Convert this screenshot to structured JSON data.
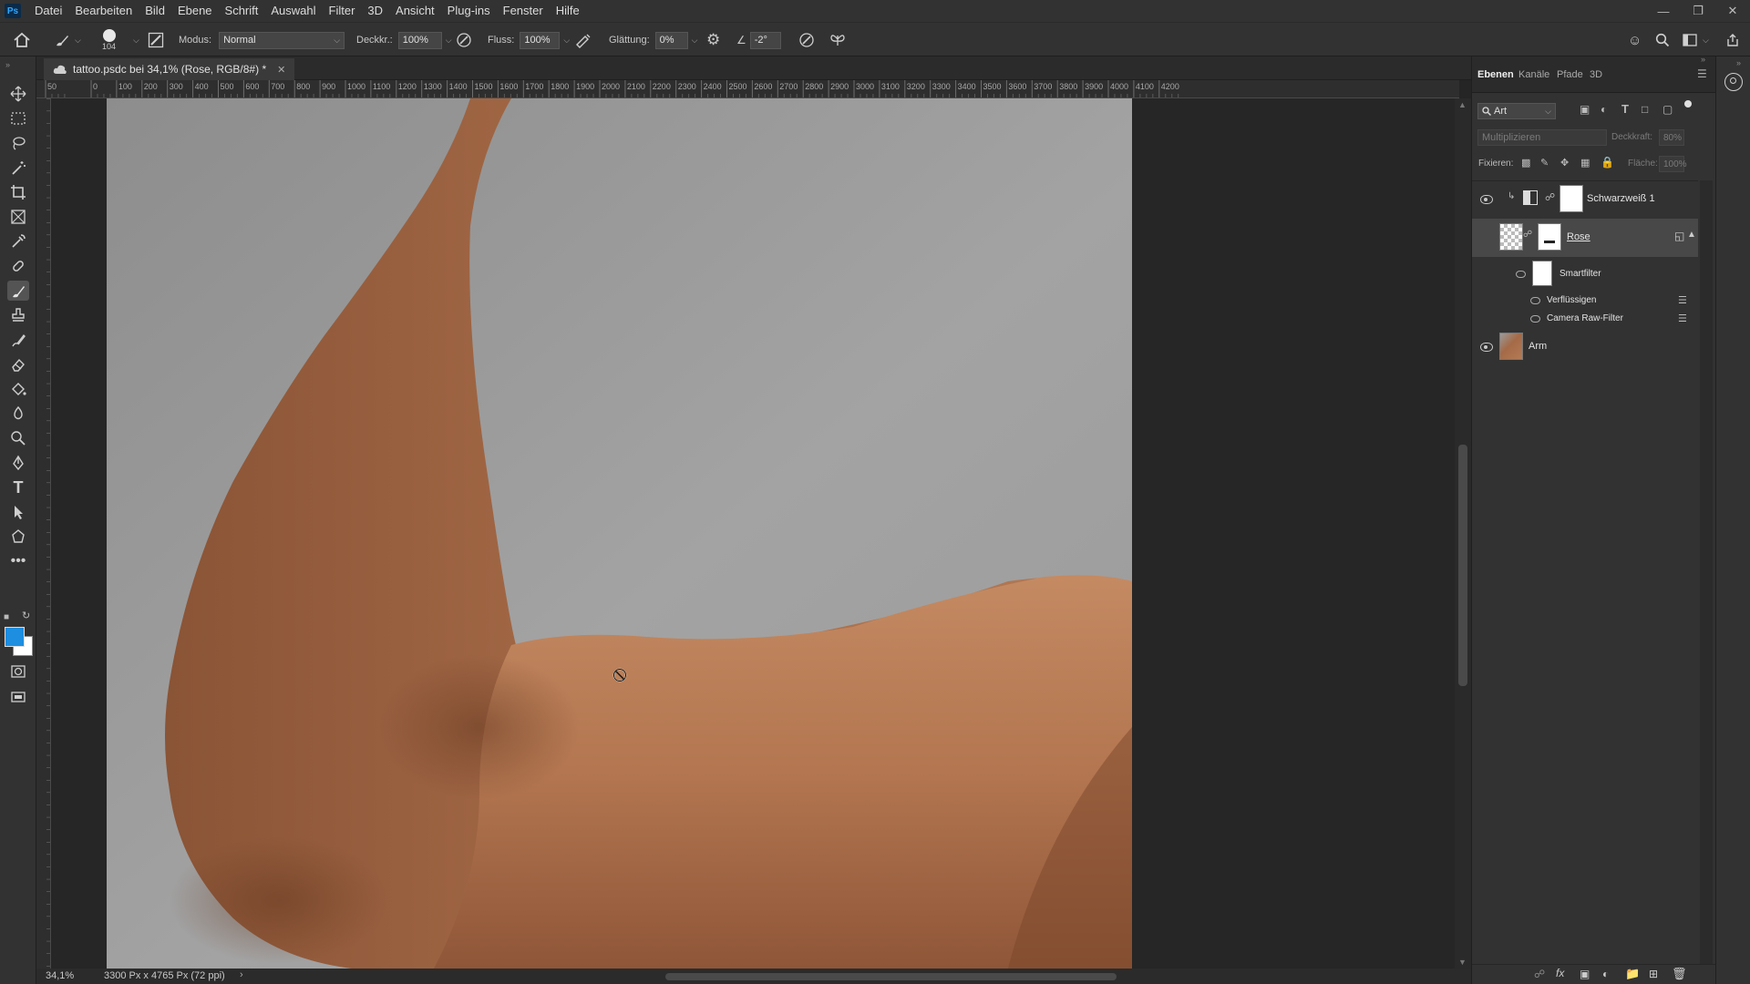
{
  "app": {
    "logo": "Ps"
  },
  "menu": [
    "Datei",
    "Bearbeiten",
    "Bild",
    "Ebene",
    "Schrift",
    "Auswahl",
    "Filter",
    "3D",
    "Ansicht",
    "Plug-ins",
    "Fenster",
    "Hilfe"
  ],
  "options": {
    "brush_size": "104",
    "modus_label": "Modus:",
    "modus_value": "Normal",
    "deckkraft_label": "Deckkr.:",
    "deckkraft_value": "100%",
    "fluss_label": "Fluss:",
    "fluss_value": "100%",
    "glaettung_label": "Glättung:",
    "glaettung_value": "0%",
    "angle_value": "-2°"
  },
  "document": {
    "tab_title": "tattoo.psdc bei 34,1% (Rose, RGB/8#) *",
    "zoom": "34,1%",
    "doc_info": "3300 Px x 4765 Px (72 ppi)"
  },
  "ruler_labels": [
    "50",
    "0",
    "100",
    "200",
    "300",
    "400",
    "500",
    "600",
    "700",
    "800",
    "900",
    "1000",
    "1100",
    "1200",
    "1300",
    "1400",
    "1500",
    "1600",
    "1700",
    "1800",
    "1900",
    "2000",
    "2100",
    "2200",
    "2300",
    "2400",
    "2500",
    "2600",
    "2700",
    "2800",
    "2900",
    "3000",
    "3100",
    "3200",
    "3300",
    "3400",
    "3500",
    "3600",
    "3700",
    "3800",
    "3900",
    "4000",
    "4100",
    "4200"
  ],
  "layers_panel": {
    "tabs": [
      "Ebenen",
      "Kanäle",
      "Pfade",
      "3D"
    ],
    "filter_kind": "Art",
    "blend_mode": "Multiplizieren",
    "opacity_label": "Deckkraft:",
    "opacity_value": "80%",
    "lock_label": "Fixieren:",
    "fill_label": "Fläche:",
    "fill_value": "100%",
    "layers": [
      {
        "name": "Schwarzweiß 1"
      },
      {
        "name": "Rose"
      },
      {
        "name": "Smartfilter"
      },
      {
        "name": "Verflüssigen"
      },
      {
        "name": "Camera Raw-Filter"
      },
      {
        "name": "Arm"
      }
    ]
  },
  "colors": {
    "foreground": "#1e8ee0",
    "background": "#ffffff",
    "accent": "#31a8ff"
  }
}
